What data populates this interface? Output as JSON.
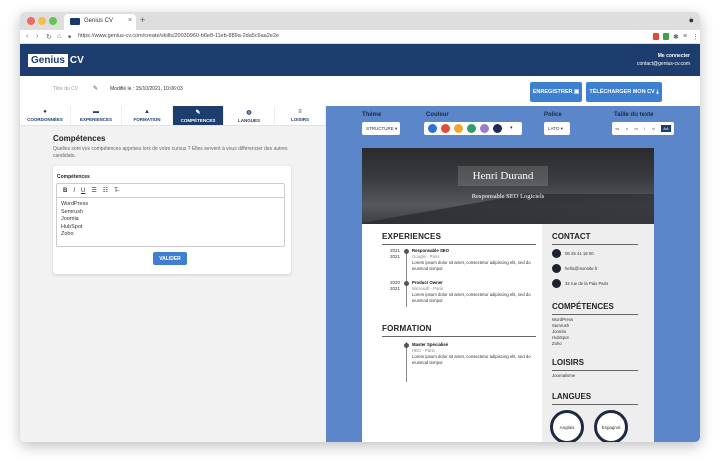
{
  "browser": {
    "tab_title": "Genius CV",
    "url": "https://www.genius-cv.com/create/skills/20030960-b6e8-11eb-889a-2da5c6aa2e2e",
    "close_glyph": "×",
    "new_tab_glyph": "+",
    "back_glyph": "‹",
    "forward_glyph": "›",
    "reload_glyph": "↻",
    "menu_glyph": "⋮"
  },
  "site": {
    "logo_left": "Genius",
    "logo_right": "CV",
    "account_link": "Me connecter",
    "account_email": "contact@genius-cv.com"
  },
  "toolbar": {
    "cv_title": "Titre du CV",
    "modified": "Modifié le : 15/10/2021, 10:06:03",
    "save_label": "ENREGISTRER ▣",
    "download_label": "TÉLÉCHARGER MON CV ⤓"
  },
  "nav": {
    "tabs": [
      {
        "label": "COORDONNÉES",
        "icon": "user-icon",
        "glyph": "●"
      },
      {
        "label": "EXPÉRIENCES",
        "icon": "briefcase-icon",
        "glyph": "▬"
      },
      {
        "label": "FORMATION",
        "icon": "graduation-cap-icon",
        "glyph": "▲"
      },
      {
        "label": "COMPÉTENCES",
        "icon": "wrench-icon",
        "glyph": "✎"
      },
      {
        "label": "LANGUES",
        "icon": "globe-icon",
        "glyph": "◍"
      },
      {
        "label": "LOISIRS",
        "icon": "list-icon",
        "glyph": "≡"
      }
    ],
    "active_index": 3
  },
  "skills_form": {
    "title": "Compétences",
    "description": "Quelles sont vos compétences apprises lors de votre cursus ? Elles servent à vous différencier des autres candidats.",
    "field_label": "Compétences",
    "editor_tools": [
      "B",
      "I",
      "U",
      "☰",
      "☷",
      "T̶"
    ],
    "editor_lines": [
      "WordPress",
      "Semrush",
      "Joomla",
      "HubSpot",
      "Zoho"
    ],
    "submit_label": "VALIDER"
  },
  "design": {
    "theme_label": "Thème",
    "theme_value": "STRUCTURE ▾",
    "color_label": "Couleur",
    "colors": [
      "#2f6fd6",
      "#e8483b",
      "#f2a531",
      "#2f9e6b",
      "#9a7ccc",
      "#1c2a55"
    ],
    "color_more": "▾",
    "font_label": "Police",
    "font_value": "LATO ▾",
    "size_label": "Taille du texte",
    "sizes": [
      "xs",
      "s",
      "m",
      "l",
      "xl"
    ],
    "size_selected": "AA"
  },
  "cv": {
    "name": "Henri Durand",
    "job_title": "Responsable SEO Logiciels",
    "experiences_heading": "EXPERIENCES",
    "experiences": [
      {
        "year_from": "2021",
        "year_to": "2021",
        "title": "Responsable SEO",
        "company": "Google - Paris",
        "desc": "Lorem ipsum dolor sit amet, consectetur adipiscing elit, sed do eiusmod tempor"
      },
      {
        "year_from": "2020",
        "year_to": "2021",
        "title": "Product Owner",
        "company": "Microsoft - Paris",
        "desc": "Lorem ipsum dolor sit amet, consectetur adipiscing elit, sed do eiusmod tempor"
      }
    ],
    "formation_heading": "FORMATION",
    "formation": [
      {
        "title": "Master Spécialisé",
        "school": "HEC - Paris",
        "desc": "Lorem ipsum dolor sit amet, consectetur adipiscing elit, sed do eiusmod tempor"
      }
    ],
    "contact_heading": "CONTACT",
    "contact": [
      {
        "icon": "phone-icon",
        "value": "06 25 41 19 00"
      },
      {
        "icon": "email-icon",
        "value": "hello@monsite.fr"
      },
      {
        "icon": "location-icon",
        "value": "32 rue de la Paix Paris"
      }
    ],
    "skills_heading": "COMPÉTENCES",
    "skills": [
      "WordPress",
      "Semrush",
      "Joomla",
      "HubSpot",
      "Zoho"
    ],
    "hobbies_heading": "LOISIRS",
    "hobbies": [
      "Journalisme"
    ],
    "languages_heading": "LANGUES",
    "languages": [
      "Anglais",
      "Espagnol"
    ]
  }
}
